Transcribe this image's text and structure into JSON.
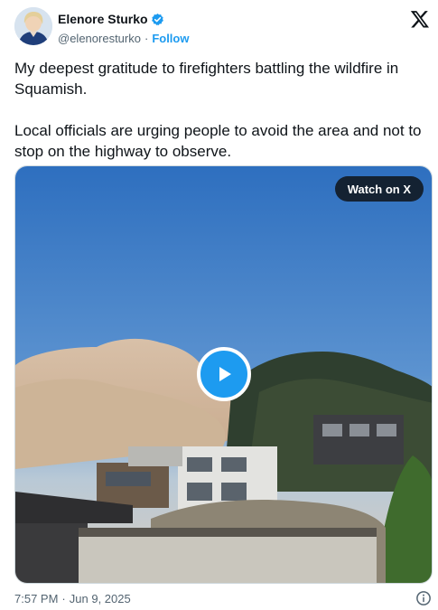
{
  "author": {
    "display_name": "Elenore Sturko",
    "handle": "@elenoresturko",
    "separator": "·",
    "follow_label": "Follow",
    "verified_icon": "verified-badge-icon"
  },
  "tweet": {
    "paragraphs": [
      "My deepest gratitude to firefighters battling the wildfire in Squamish.",
      "Local officials are urging people to avoid the area and not to stop on the highway to observe."
    ]
  },
  "media": {
    "type": "video",
    "watch_label": "Watch on X",
    "play_icon": "play-icon"
  },
  "footer": {
    "time": "7:57 PM",
    "separator": "·",
    "date": "Jun 9, 2025",
    "info_icon": "info-icon"
  },
  "brand": {
    "logo": "x-logo-icon",
    "accent_color": "#1d9bf0",
    "text_color": "#0f1419",
    "secondary_text_color": "#536471"
  }
}
